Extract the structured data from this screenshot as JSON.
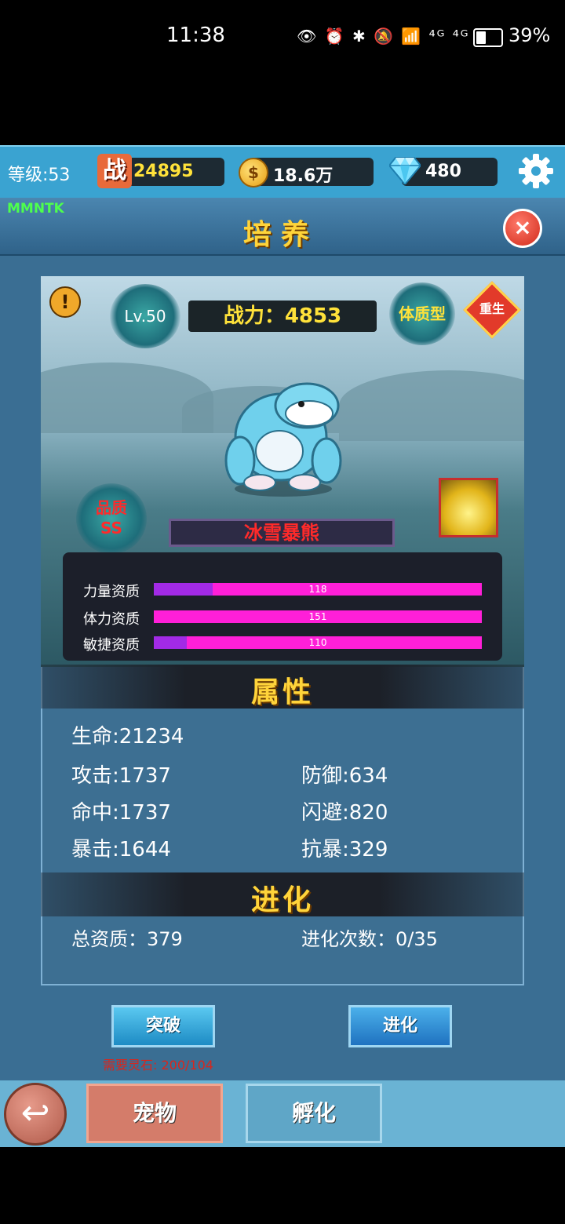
{
  "status_bar": {
    "time": "11:38",
    "icons_text": "👁 ⏰ ✱ 🔕 📶 ⁴ᴳ ⁴ᴳ",
    "battery": "39%",
    "battery_level": 0.39
  },
  "topbar": {
    "level_label": "等级:53",
    "zhan_icon_char": "战",
    "battle_power": "24895",
    "coin_icon_char": "$",
    "gold": "18.6万",
    "diamonds": "480"
  },
  "panel": {
    "tag": "MMNTK",
    "title": "培养",
    "close_char": "×"
  },
  "pet": {
    "info_char": "!",
    "level": "Lv.50",
    "power": "战力：4853",
    "type": "体质型",
    "rebirth": "重生",
    "quality_label": "品质",
    "quality_value": "SS",
    "name": "冰雪暴熊",
    "aptitudes": [
      {
        "label": "力量资质",
        "value": "118",
        "fill": 0.18
      },
      {
        "label": "体力资质",
        "value": "151",
        "fill": 0.0
      },
      {
        "label": "敏捷资质",
        "value": "110",
        "fill": 0.1
      }
    ]
  },
  "attributes": {
    "header": "属性",
    "hp": "生命:21234",
    "attack": "攻击:1737",
    "defense": "防御:634",
    "hit": "命中:1737",
    "dodge": "闪避:820",
    "crit": "暴击:1644",
    "crit_resist": "抗暴:329"
  },
  "evolution": {
    "header": "进化",
    "total_aptitude": "总资质：379",
    "evolve_count": "进化次数：0/35"
  },
  "buttons": {
    "breakthrough": "突破",
    "evolve": "进化",
    "requirement": "需要灵石: 200/104"
  },
  "bottom_nav": {
    "back_char": "↩",
    "tab_pet": "宠物",
    "tab_hatch": "孵化"
  },
  "colors": {
    "accent_gold": "#ffd43a",
    "bar_magenta": "#ff1fd8",
    "name_red": "#ff2a2a",
    "topbar_blue": "#3aa3d1"
  }
}
